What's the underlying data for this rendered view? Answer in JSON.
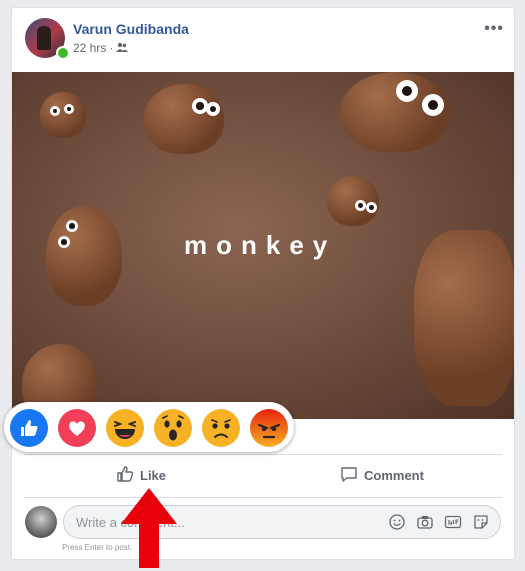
{
  "post": {
    "author": "Varun Gudibanda",
    "time": "22 hrs",
    "separator": "·",
    "audience_icon": "friends-icon",
    "more_icon": "more-options-icon"
  },
  "media": {
    "caption": "monkey",
    "background_color": "#6c4a3a"
  },
  "reactions": [
    {
      "name": "like",
      "icon": "like-reaction-icon",
      "color": "#1877f2"
    },
    {
      "name": "love",
      "icon": "love-reaction-icon",
      "color": "#f33e58"
    },
    {
      "name": "haha",
      "icon": "haha-reaction-icon",
      "color": "#f7b125"
    },
    {
      "name": "wow",
      "icon": "wow-reaction-icon",
      "color": "#f7b125"
    },
    {
      "name": "sad",
      "icon": "sad-reaction-icon",
      "color": "#f7b125"
    },
    {
      "name": "angry",
      "icon": "angry-reaction-icon",
      "color": "#e9710f"
    }
  ],
  "actions": {
    "like_label": "Like",
    "comment_label": "Comment"
  },
  "comment_box": {
    "placeholder": "Write a comment...",
    "hint": "Press Enter to post."
  },
  "annotation": {
    "arrow_color": "#e8000b"
  },
  "colors": {
    "link": "#365899",
    "online": "#42b72a"
  }
}
